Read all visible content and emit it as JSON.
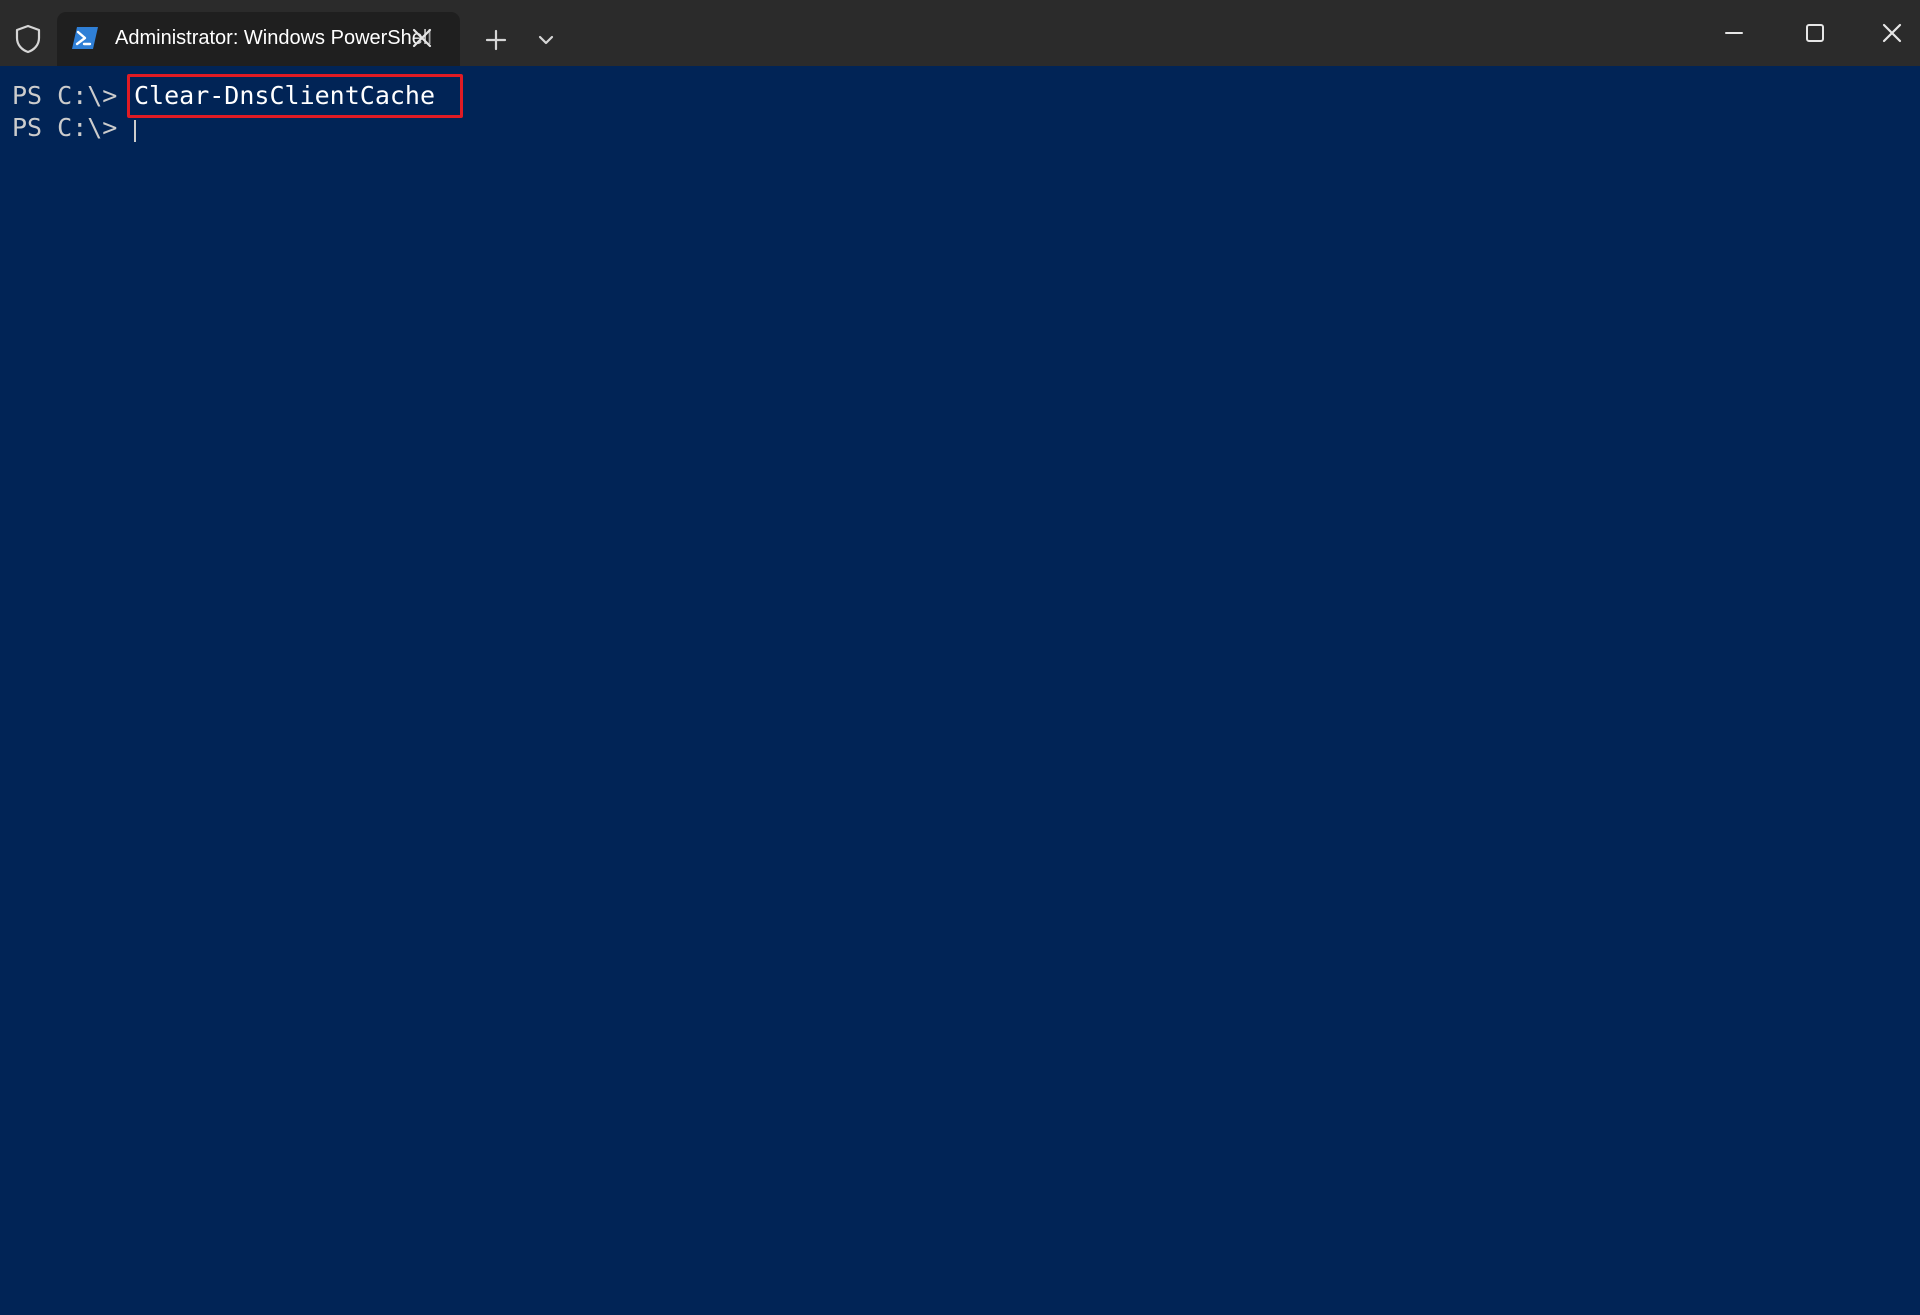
{
  "window": {
    "tab_title": "Administrator: Windows PowerShell",
    "icons": {
      "shield": "shield-icon",
      "tab": "powershell-icon",
      "tab_close": "close-icon",
      "new_tab": "plus-icon",
      "dropdown": "chevron-down-icon",
      "minimize": "minimize-icon",
      "maximize": "maximize-icon",
      "close": "close-icon"
    }
  },
  "console": {
    "lines": [
      {
        "prompt": "PS C:\\> ",
        "command": "Clear-DnsClientCache"
      },
      {
        "prompt": "PS C:\\> ",
        "command": ""
      }
    ]
  },
  "colors": {
    "background": "#012456",
    "titlebar": "#2b2b2b",
    "tab": "#1f1f1f",
    "highlight": "#e01b24",
    "text": "#cccccc"
  }
}
